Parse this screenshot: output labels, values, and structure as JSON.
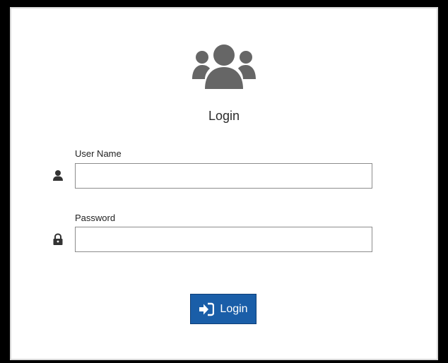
{
  "form": {
    "title": "Login",
    "username": {
      "label": "User Name",
      "value": "",
      "icon": "user-icon"
    },
    "password": {
      "label": "Password",
      "value": "",
      "icon": "lock-icon"
    },
    "submit": {
      "label": "Login",
      "icon": "sign-in-icon"
    }
  },
  "header_icon": "users-group-icon",
  "colors": {
    "accent": "#1a5ea8",
    "icon_gray": "#666666",
    "frame": "#000000"
  }
}
